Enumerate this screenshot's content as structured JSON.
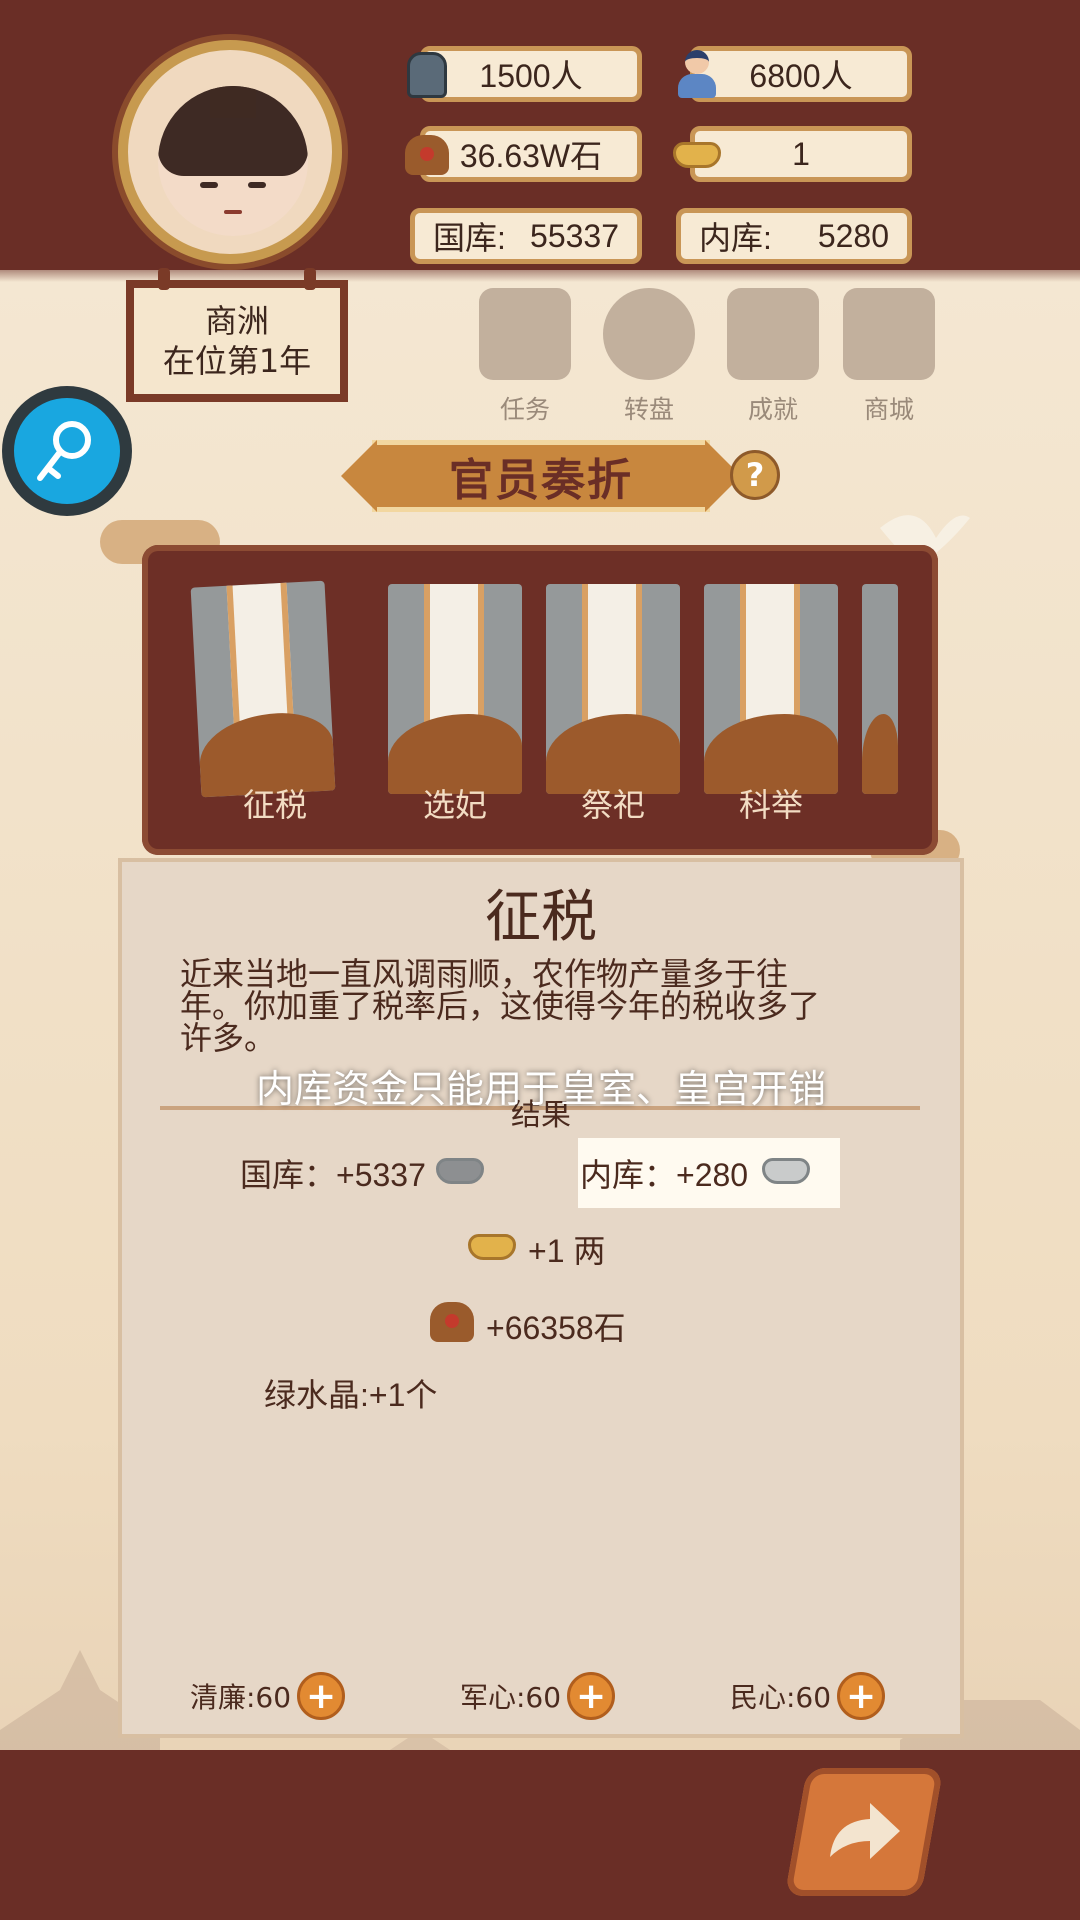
{
  "header": {
    "soldiers": "1500人",
    "population": "6800人",
    "grain": "36.63W石",
    "gold": "1",
    "state_treasury_label": "国库:",
    "state_treasury_value": "55337",
    "inner_treasury_label": "内库:",
    "inner_treasury_value": "5280"
  },
  "region": {
    "name": "商洲",
    "reign": "在位第1年"
  },
  "menu": [
    {
      "label": "任务",
      "icon": "scroll-icon"
    },
    {
      "label": "转盘",
      "icon": "wheel-icon"
    },
    {
      "label": "成就",
      "icon": "trophy-icon"
    },
    {
      "label": "商城",
      "icon": "shop-icon"
    }
  ],
  "banner": {
    "title": "官员奏折",
    "help": "?"
  },
  "cards": [
    {
      "label": "征税"
    },
    {
      "label": "选妃"
    },
    {
      "label": "祭祀"
    },
    {
      "label": "科举"
    }
  ],
  "panel": {
    "title": "征税",
    "description_lines": [
      "近来当地一直风调雨顺，农作物产量多于往",
      "年。你加重了税率后，这使得今年的税收多了",
      "许多。"
    ],
    "tooltip": "内库资金只能用于皇室、皇宫开销",
    "result_title": "结果",
    "results": {
      "state_treasury": "国库：+5337",
      "inner_treasury": "内库：+280",
      "gold": "+1 两",
      "grain": "+66358石",
      "crystal": "绿水晶:+1个"
    }
  },
  "stats": [
    {
      "label": "清廉:60"
    },
    {
      "label": "军心:60"
    },
    {
      "label": "民心:60"
    }
  ],
  "colors": {
    "maroon": "#6a2e26",
    "cream": "#f3e6cf",
    "gold_border": "#c99656",
    "accent_blue": "#19a7e0",
    "orange": "#e28a32"
  }
}
